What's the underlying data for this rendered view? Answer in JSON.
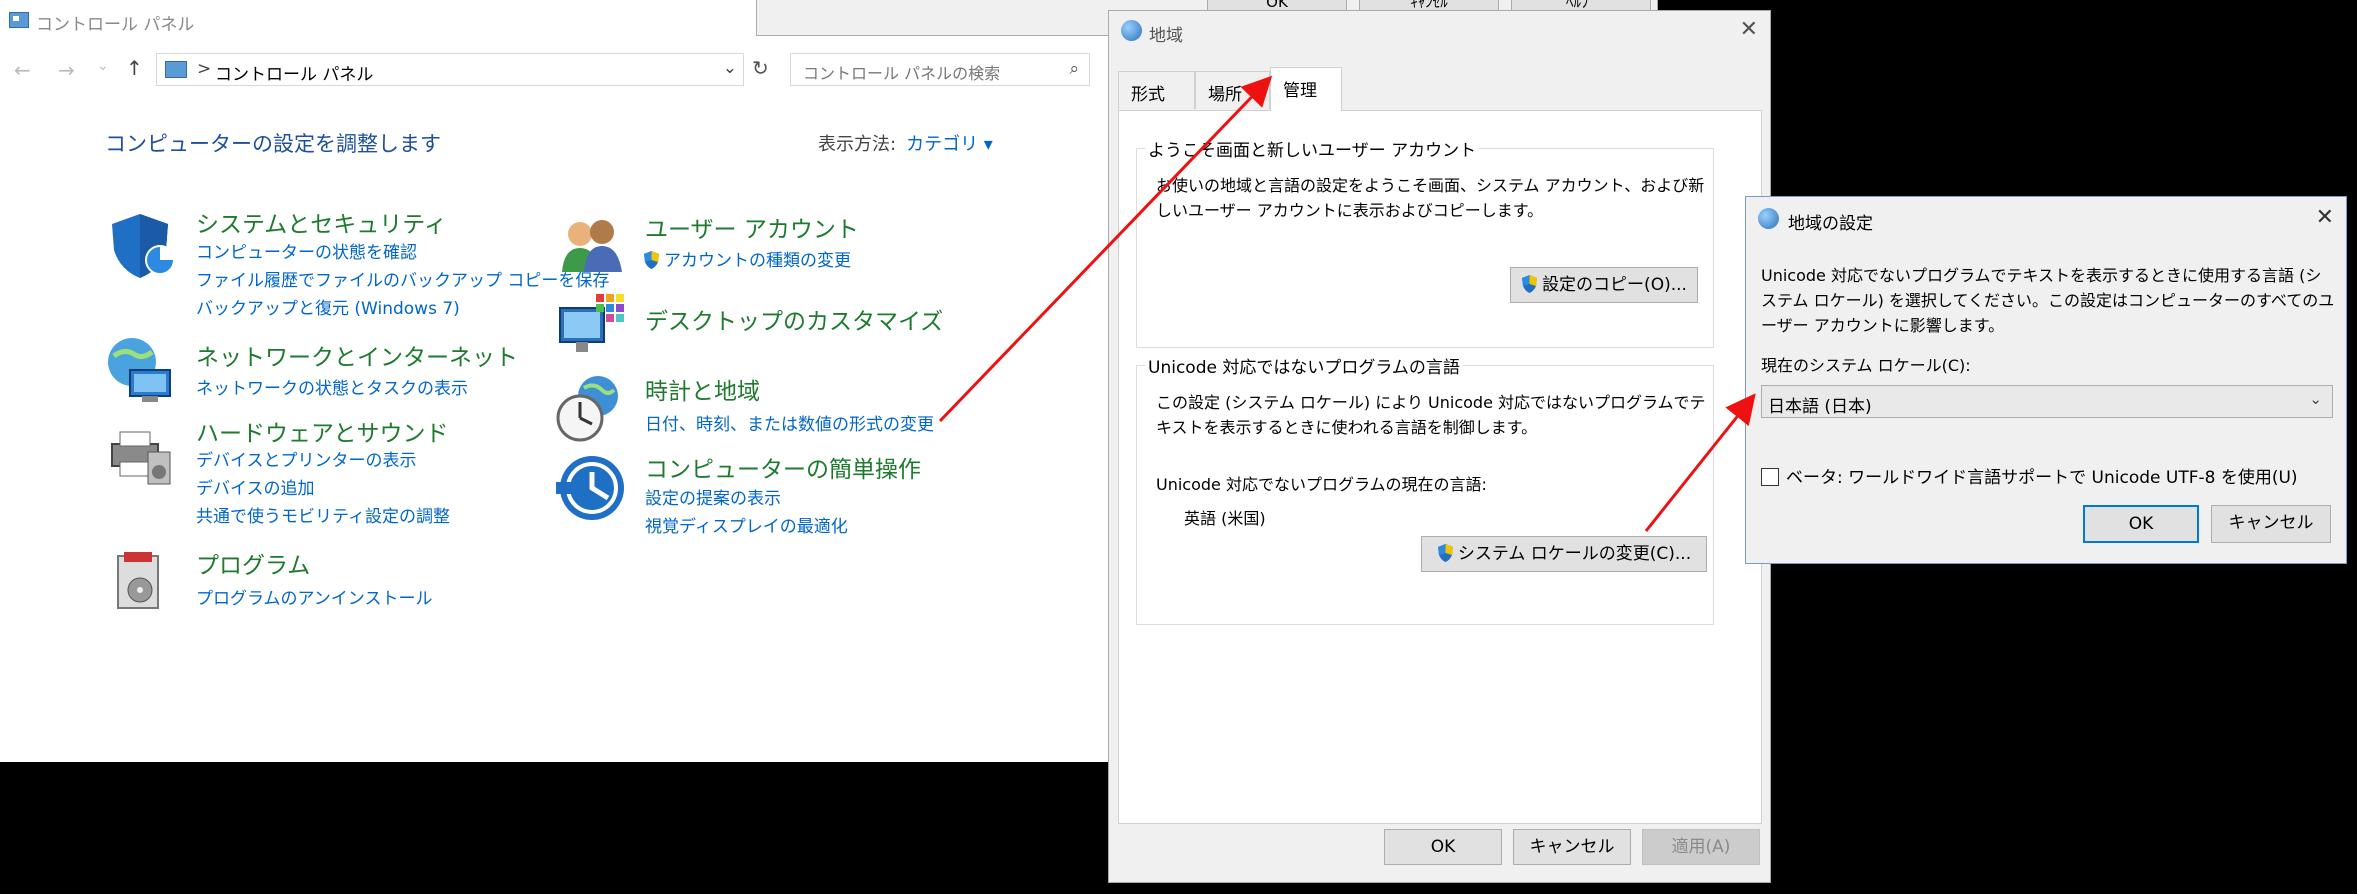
{
  "control_panel": {
    "title": "コントロール パネル",
    "address_crumb": "コントロール パネル",
    "address_separator": ">",
    "search_placeholder": "コントロール パネルの検索",
    "heading": "コンピューターの設定を調整します",
    "view_by_label": "表示方法:",
    "view_by_value": "カテゴリ ▾",
    "categories": [
      {
        "title": "システムとセキュリティ",
        "links": [
          "コンピューターの状態を確認",
          "ファイル履歴でファイルのバックアップ コピーを保存",
          "バックアップと復元 (Windows 7)"
        ]
      },
      {
        "title": "ネットワークとインターネット",
        "links": [
          "ネットワークの状態とタスクの表示"
        ]
      },
      {
        "title": "ハードウェアとサウンド",
        "links": [
          "デバイスとプリンターの表示",
          "デバイスの追加",
          "共通で使うモビリティ設定の調整"
        ]
      },
      {
        "title": "プログラム",
        "links": [
          "プログラムのアンインストール"
        ]
      },
      {
        "title": "ユーザー アカウント",
        "links": [
          "アカウントの種類の変更"
        ]
      },
      {
        "title": "デスクトップのカスタマイズ",
        "links": []
      },
      {
        "title": "時計と地域",
        "links": [
          "日付、時刻、または数値の形式の変更"
        ]
      },
      {
        "title": "コンピューターの簡単操作",
        "links": [
          "設定の提案の表示",
          "視覚ディスプレイの最適化"
        ]
      }
    ]
  },
  "top_partial": {
    "buttons": [
      "OK",
      "ｷｬﾝｾﾙ",
      "ﾍﾙﾌﾟ"
    ]
  },
  "region_dialog": {
    "title": "地域",
    "tabs": [
      "形式",
      "場所",
      "管理"
    ],
    "group1": {
      "legend": "ようこそ画面と新しいユーザー アカウント",
      "text": "お使いの地域と言語の設定をようこそ画面、システム アカウント、および新しいユーザー アカウントに表示およびコピーします。",
      "button": "設定のコピー(O)..."
    },
    "group2": {
      "legend": "Unicode 対応ではないプログラムの言語",
      "text": "この設定 (システム ロケール) により Unicode 対応ではないプログラムでテキストを表示するときに使われる言語を制御します。",
      "current_label": "Unicode 対応でないプログラムの現在の言語:",
      "current_value": "英語 (米国)",
      "button": "システム ロケールの変更(C)..."
    },
    "ok": "OK",
    "cancel": "キャンセル",
    "apply": "適用(A)"
  },
  "region_settings": {
    "title": "地域の設定",
    "description": "Unicode 対応でないプログラムでテキストを表示するときに使用する言語 (システム ロケール) を選択してください。この設定はコンピューターのすべてのユーザー アカウントに影響します。",
    "locale_label": "現在のシステム ロケール(C):",
    "locale_value": "日本語 (日本)",
    "beta_checkbox_label": "ベータ: ワールドワイド言語サポートで Unicode UTF-8 を使用(U)",
    "beta_checked": false,
    "ok": "OK",
    "cancel": "キャンセル"
  },
  "colors": {
    "category_title": "#1e7a2e",
    "link": "#0066cc",
    "heading": "#1e4f9c",
    "annotation_arrow": "#ee1111"
  }
}
